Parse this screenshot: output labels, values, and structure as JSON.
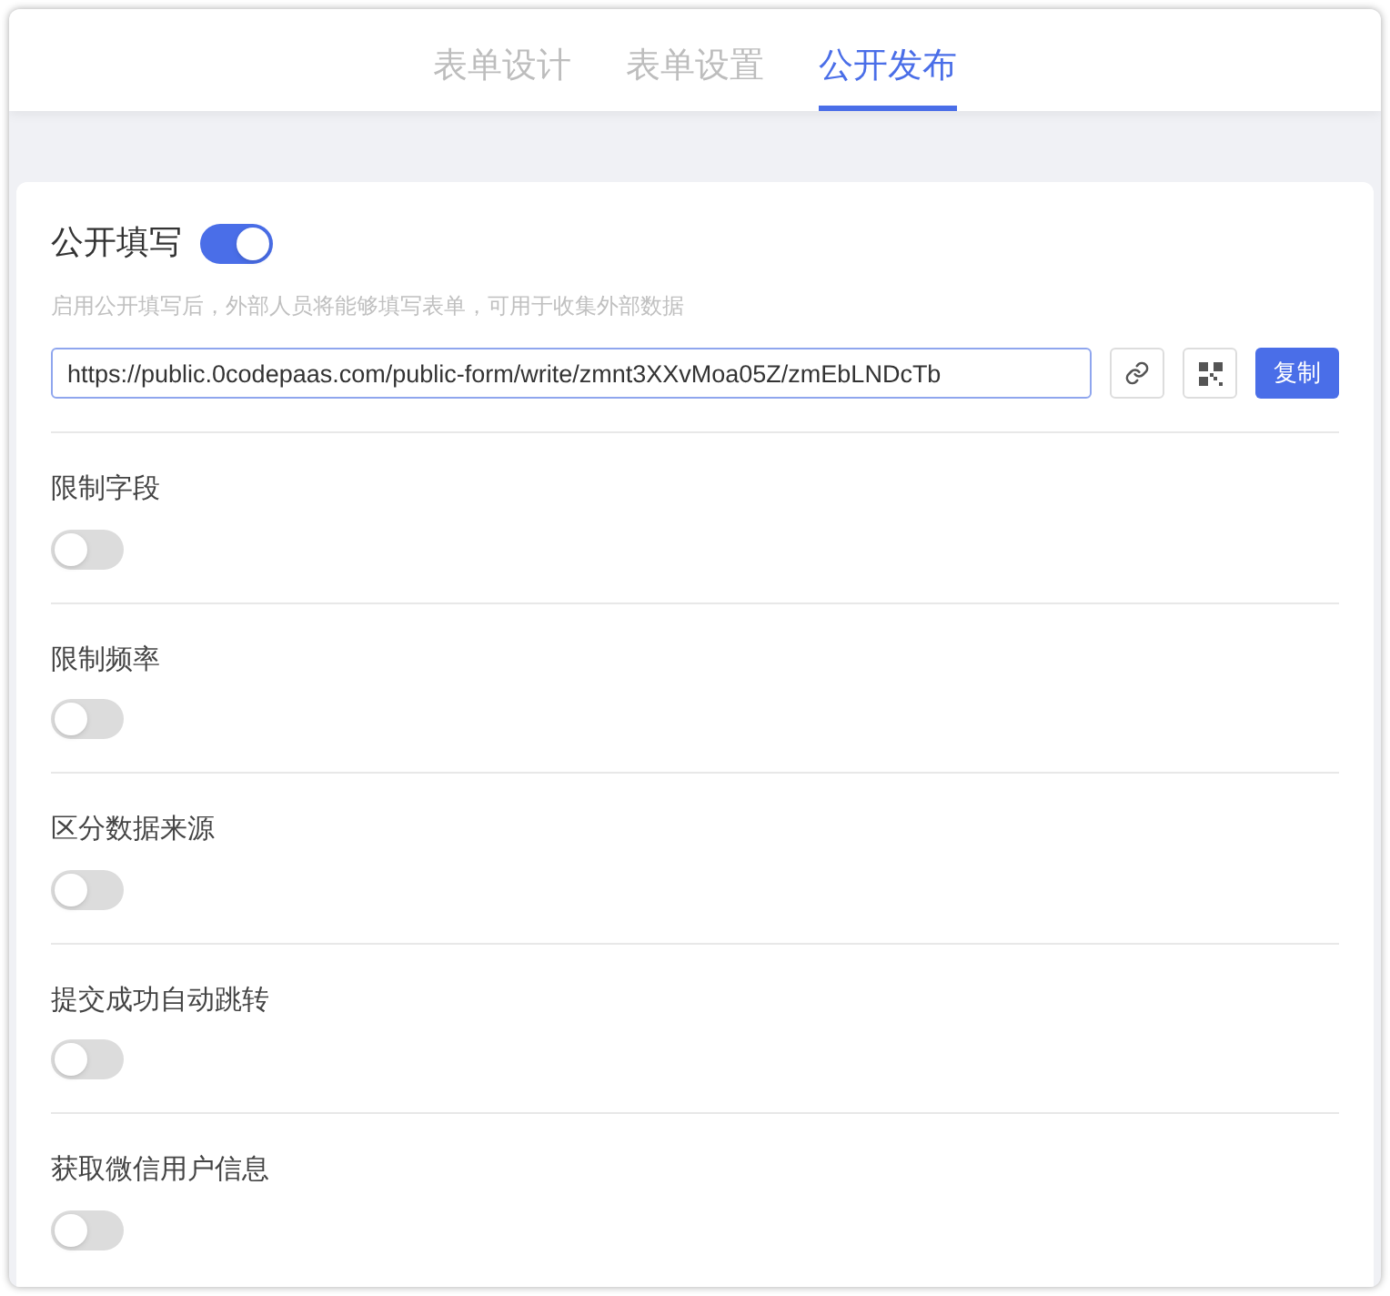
{
  "tabs": [
    {
      "label": "表单设计",
      "selected": false
    },
    {
      "label": "表单设置",
      "selected": false
    },
    {
      "label": "公开发布",
      "selected": true
    }
  ],
  "public_fill": {
    "label": "公开填写",
    "on": true,
    "description": "启用公开填写后，外部人员将能够填写表单，可用于收集外部数据",
    "url": "https://public.0codepaas.com/public-form/write/zmnt3XXvMoa05Z/zmEbLNDcTb",
    "copy_button": "复制"
  },
  "settings": [
    {
      "label": "限制字段",
      "on": false
    },
    {
      "label": "限制频率",
      "on": false
    },
    {
      "label": "区分数据来源",
      "on": false
    },
    {
      "label": "提交成功自动跳转",
      "on": false
    },
    {
      "label": "获取微信用户信息",
      "on": false
    }
  ]
}
